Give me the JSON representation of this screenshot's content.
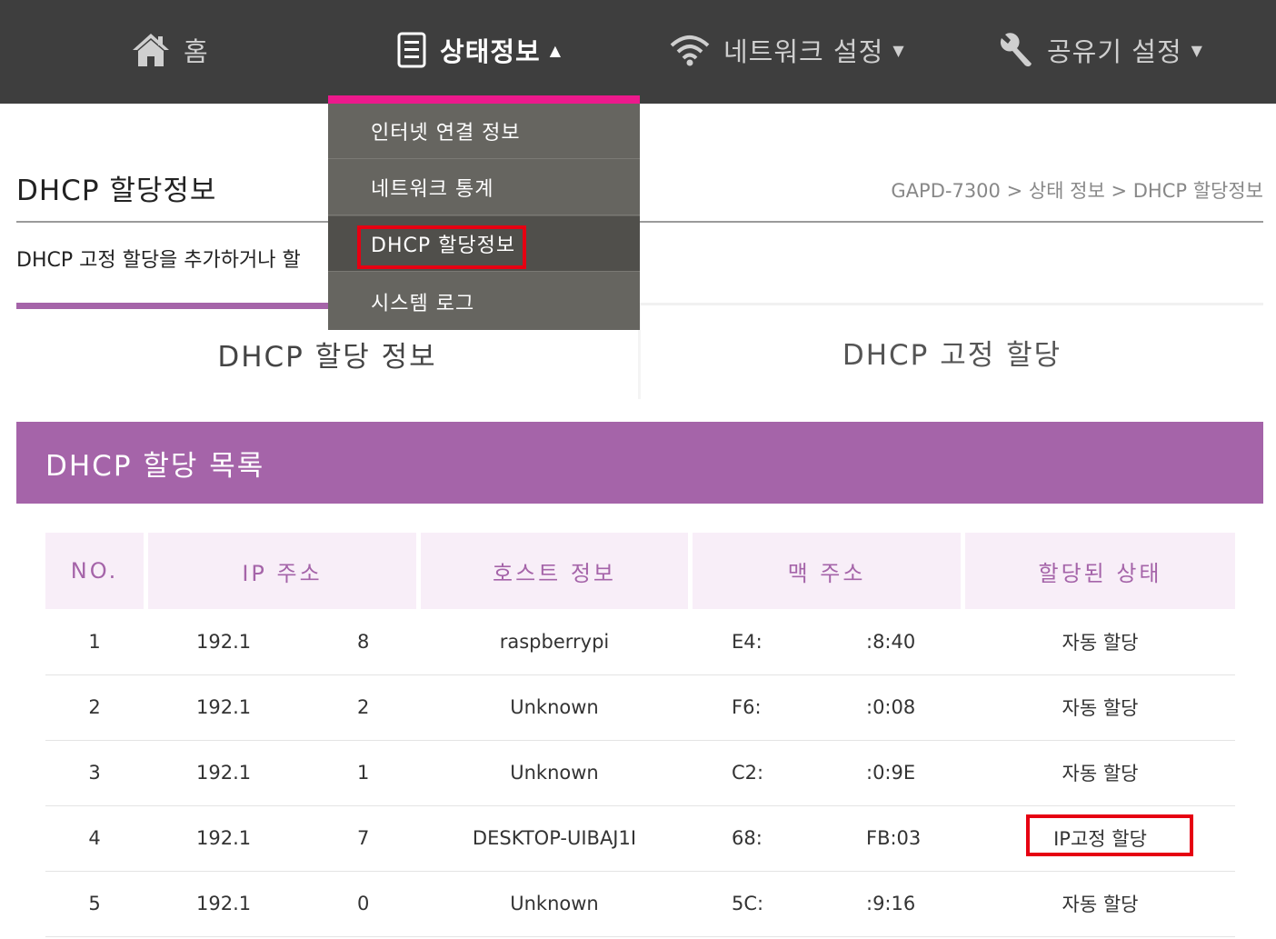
{
  "nav": {
    "home": "홈",
    "status": "상태정보",
    "network": "네트워크 설정",
    "router": "공유기 설정"
  },
  "dropdown": {
    "items": [
      "인터넷 연결 정보",
      "네트워크 통계",
      "DHCP 할당정보",
      "시스템 로그"
    ],
    "accent_color": "#ec198c"
  },
  "page": {
    "title": "DHCP 할당정보",
    "breadcrumb": "GAPD-7300 > 상태 정보 > DHCP 할당정보",
    "description": "DHCP 고정 할당을 추가하거나 할"
  },
  "tabs": [
    "DHCP 할당 정보",
    "DHCP 고정 할당"
  ],
  "section": {
    "title": "DHCP 할당 목록",
    "color": "#a564a9"
  },
  "table": {
    "headers": [
      "NO.",
      "IP 주소",
      "호스트 정보",
      "맥 주소",
      "할당된 상태"
    ],
    "rows": [
      {
        "no": "1",
        "ip_a": "192.1",
        "ip_b": "8",
        "host": "raspberrypi",
        "mac_a": "E4:",
        "mac_b": ":8:40",
        "state": "자동 할당"
      },
      {
        "no": "2",
        "ip_a": "192.1",
        "ip_b": "2",
        "host": "Unknown",
        "mac_a": "F6:",
        "mac_b": ":0:08",
        "state": "자동 할당"
      },
      {
        "no": "3",
        "ip_a": "192.1",
        "ip_b": "1",
        "host": "Unknown",
        "mac_a": "C2:",
        "mac_b": ":0:9E",
        "state": "자동 할당"
      },
      {
        "no": "4",
        "ip_a": "192.1",
        "ip_b": "7",
        "host": "DESKTOP-UIBAJ1I",
        "mac_a": "68:",
        "mac_b": "FB:03",
        "state": "IP고정 할당"
      },
      {
        "no": "5",
        "ip_a": "192.1",
        "ip_b": "0",
        "host": "Unknown",
        "mac_a": "5C:",
        "mac_b": ":9:16",
        "state": "자동 할당"
      }
    ]
  },
  "highlight_color": "#e60012"
}
